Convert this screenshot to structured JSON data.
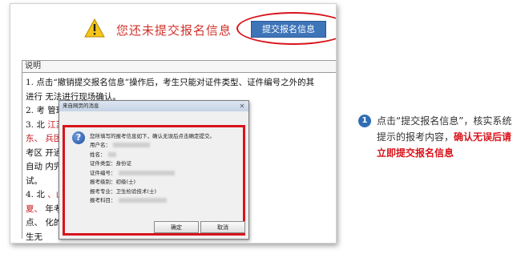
{
  "warning": {
    "text": "您还未提交报名信息",
    "submit_label": "提交报名信息"
  },
  "explanation": {
    "header": "说明",
    "lines": [
      [
        {
          "t": "1. 点击“撤销提交报名信息”操作后，考生只能对证件类型、证件编号之外的其"
        }
      ],
      [
        {
          "t": "进行"
        },
        {
          "t": "                                            ",
          "red": true
        },
        {
          "t": "无法进行现场确认。"
        }
      ],
      [
        {
          "t": "2. 考"
        },
        {
          "t": "                                    "
        },
        {
          "t": "管理机构指定地点进行现"
        }
      ],
      [
        {
          "t": "3. 北"
        },
        {
          "t": "                                  "
        },
        {
          "t": "江苏、浙江、安徽、福建",
          "red": true
        }
      ],
      [
        {
          "t": "东、",
          "red": true
        },
        {
          "t": "                                   "
        },
        {
          "t": "兵团",
          "red": true
        },
        {
          "t": "考区采用网上缴费"
        }
      ],
      [
        {
          "t": "考区"
        },
        {
          "t": "                                      "
        },
        {
          "t": "开通历史考生自动确认的"
        }
      ],
      [
        {
          "t": "自动"
        },
        {
          "t": "                                      "
        },
        {
          "t": "内完成缴费的，视为自动"
        }
      ],
      [
        {
          "t": "试。"
        }
      ],
      [
        {
          "t": "4. 北"
        },
        {
          "t": "                                  "
        },
        {
          "t": "、山东、河南、重庆、四",
          "red": true
        }
      ],
      [
        {
          "t": "夏、",
          "red": true
        },
        {
          "t": "                                    "
        },
        {
          "t": "年考试未通过考生，报考"
        }
      ],
      [
        {
          "t": "点、"
        },
        {
          "t": "                                      "
        },
        {
          "t": "化的，系统会提示已自"
        }
      ],
      [
        {
          "t": "生无"
        }
      ]
    ]
  },
  "dialog": {
    "title": "来自网页的消息",
    "close_glyph": "✕",
    "intro": "您所填写的报考信息如下，确认无误后点击确定提交。",
    "fields": [
      {
        "label": "用户名：",
        "value": "",
        "blur": 46
      },
      {
        "label": "姓名：",
        "value": "",
        "blur": 10
      },
      {
        "label": "证件类型：",
        "value": "身份证",
        "blur": 0
      },
      {
        "label": "证件编号：",
        "value": "",
        "blur": 70
      },
      {
        "label": "报考级别：",
        "value": "初级(士)",
        "blur": 0
      },
      {
        "label": "报考专业：",
        "value": "卫生检验技术(士)",
        "blur": 0
      },
      {
        "label": "报考科目：",
        "value": "",
        "blur": 60
      }
    ],
    "ok_label": "确定",
    "cancel_label": "取消"
  },
  "annotation": {
    "step": "1",
    "text_normal": "点击“提交报名信息”，核实系统提示的报考内容，",
    "text_highlight": "确认无误后请立即提交报名信息"
  },
  "colors": {
    "accent_red": "#d8141c",
    "button_blue": "#3e74b8",
    "badge_blue": "#2f6eb5"
  }
}
